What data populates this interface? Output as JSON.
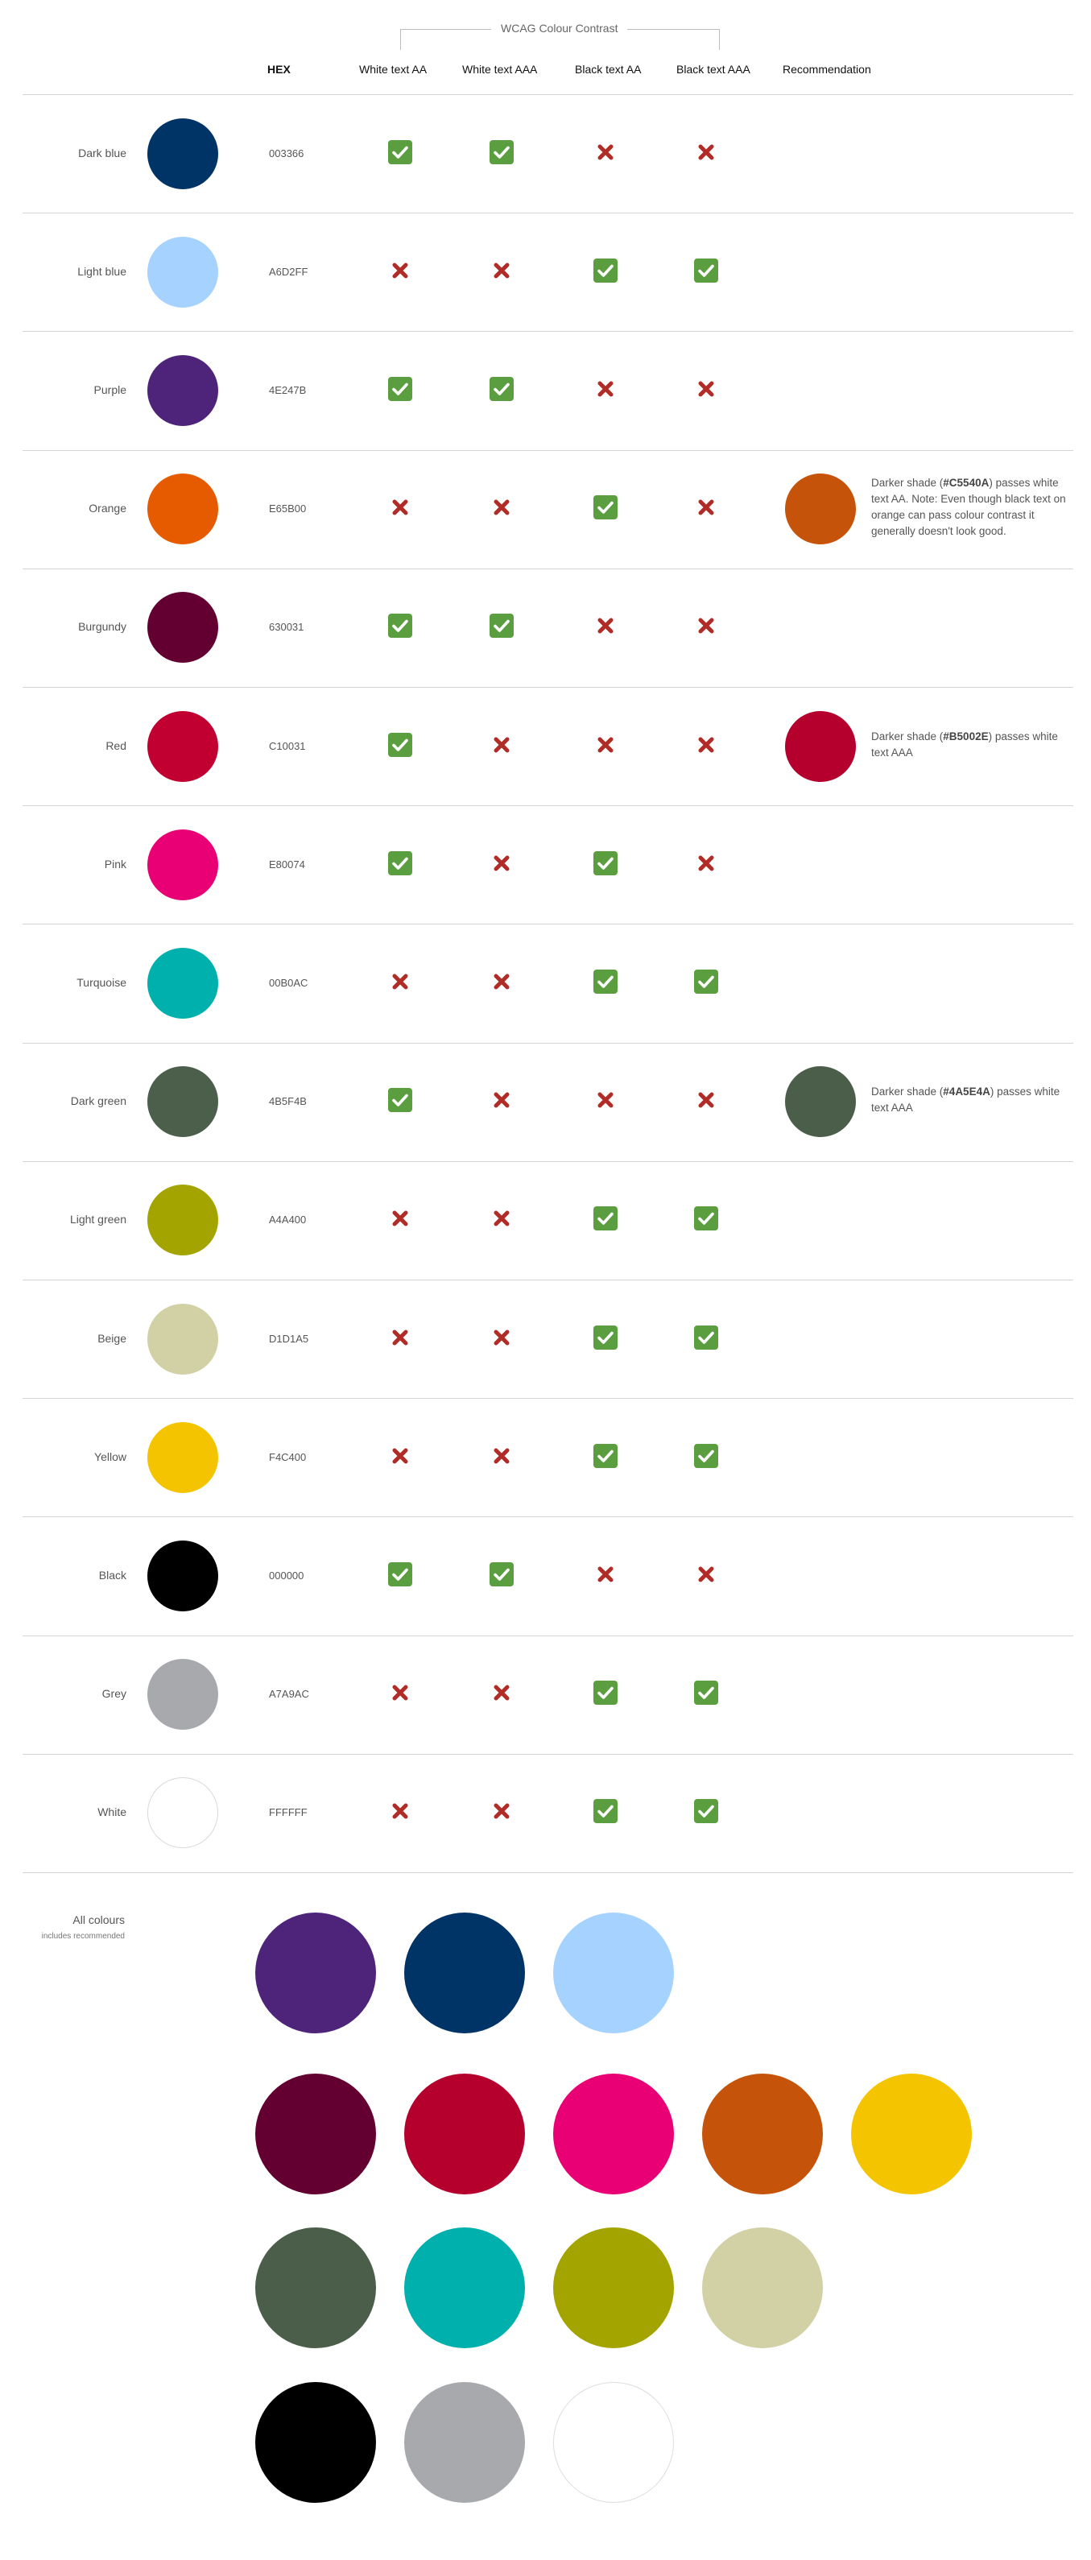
{
  "header": {
    "wcag_title": "WCAG Colour Contrast",
    "columns": {
      "hex": "HEX",
      "white_aa": "White text AA",
      "white_aaa": "White text AAA",
      "black_aa": "Black text AA",
      "black_aaa": "Black text AAA",
      "recommendation": "Recommendation"
    }
  },
  "colors": [
    {
      "name": "Dark blue",
      "hex": "003366",
      "swatch": "#003366",
      "white_aa": true,
      "white_aaa": true,
      "black_aa": false,
      "black_aaa": false
    },
    {
      "name": "Light blue",
      "hex": "A6D2FF",
      "swatch": "#A6D2FF",
      "white_aa": false,
      "white_aaa": false,
      "black_aa": true,
      "black_aaa": true
    },
    {
      "name": "Purple",
      "hex": "4E247B",
      "swatch": "#4E247B",
      "white_aa": true,
      "white_aaa": true,
      "black_aa": false,
      "black_aaa": false
    },
    {
      "name": "Orange",
      "hex": "E65B00",
      "swatch": "#E65B00",
      "white_aa": false,
      "white_aaa": false,
      "black_aa": true,
      "black_aaa": false,
      "recommendation": {
        "swatch": "#C5540A",
        "prefix": "Darker shade (",
        "code": "#C5540A",
        "suffix": ") passes white text AA. Note: Even though black text on orange can pass colour contrast it generally doesn't look good."
      }
    },
    {
      "name": "Burgundy",
      "hex": "630031",
      "swatch": "#630031",
      "white_aa": true,
      "white_aaa": true,
      "black_aa": false,
      "black_aaa": false
    },
    {
      "name": "Red",
      "hex": "C10031",
      "swatch": "#C10031",
      "white_aa": true,
      "white_aaa": false,
      "black_aa": false,
      "black_aaa": false,
      "recommendation": {
        "swatch": "#B5002E",
        "prefix": "Darker shade (",
        "code": "#B5002E",
        "suffix": ") passes white text AAA"
      }
    },
    {
      "name": "Pink",
      "hex": "E80074",
      "swatch": "#E80074",
      "white_aa": true,
      "white_aaa": false,
      "black_aa": true,
      "black_aaa": false
    },
    {
      "name": "Turquoise",
      "hex": "00B0AC",
      "swatch": "#00B0AC",
      "white_aa": false,
      "white_aaa": false,
      "black_aa": true,
      "black_aaa": true
    },
    {
      "name": "Dark green",
      "hex": "4B5F4B",
      "swatch": "#4B5F4B",
      "white_aa": true,
      "white_aaa": false,
      "black_aa": false,
      "black_aaa": false,
      "recommendation": {
        "swatch": "#4A5E4A",
        "prefix": "Darker shade (",
        "code": "#4A5E4A",
        "suffix": ") passes white text AAA"
      }
    },
    {
      "name": "Light green",
      "hex": "A4A400",
      "swatch": "#A4A400",
      "white_aa": false,
      "white_aaa": false,
      "black_aa": true,
      "black_aaa": true
    },
    {
      "name": "Beige",
      "hex": "D1D1A5",
      "swatch": "#D1D1A5",
      "white_aa": false,
      "white_aaa": false,
      "black_aa": true,
      "black_aaa": true
    },
    {
      "name": "Yellow",
      "hex": "F4C400",
      "swatch": "#F4C400",
      "white_aa": false,
      "white_aaa": false,
      "black_aa": true,
      "black_aaa": true
    },
    {
      "name": "Black",
      "hex": "000000",
      "swatch": "#000000",
      "white_aa": true,
      "white_aaa": true,
      "black_aa": false,
      "black_aaa": false
    },
    {
      "name": "Grey",
      "hex": "A7A9AC",
      "swatch": "#A7A9AC",
      "white_aa": false,
      "white_aaa": false,
      "black_aa": true,
      "black_aaa": true
    },
    {
      "name": "White",
      "hex": "FFFFFF",
      "swatch": "#FFFFFF",
      "white_aa": false,
      "white_aaa": false,
      "black_aa": true,
      "black_aaa": true
    }
  ],
  "all_colours": {
    "label": "All colours",
    "sublabel": "includes recommended",
    "rows": [
      [
        "#4E247B",
        "#003366",
        "#A6D2FF"
      ],
      [
        "#630031",
        "#B5002E",
        "#E80074",
        "#C5540A",
        "#F4C400"
      ],
      [
        "#4A5E4A",
        "#00B0AC",
        "#A4A400",
        "#D1D1A5"
      ],
      [
        "#000000",
        "#A7A9AC",
        "#FFFFFF"
      ]
    ]
  },
  "status_colors": {
    "pass": "#5a9e3f",
    "fail": "#b22c27"
  }
}
